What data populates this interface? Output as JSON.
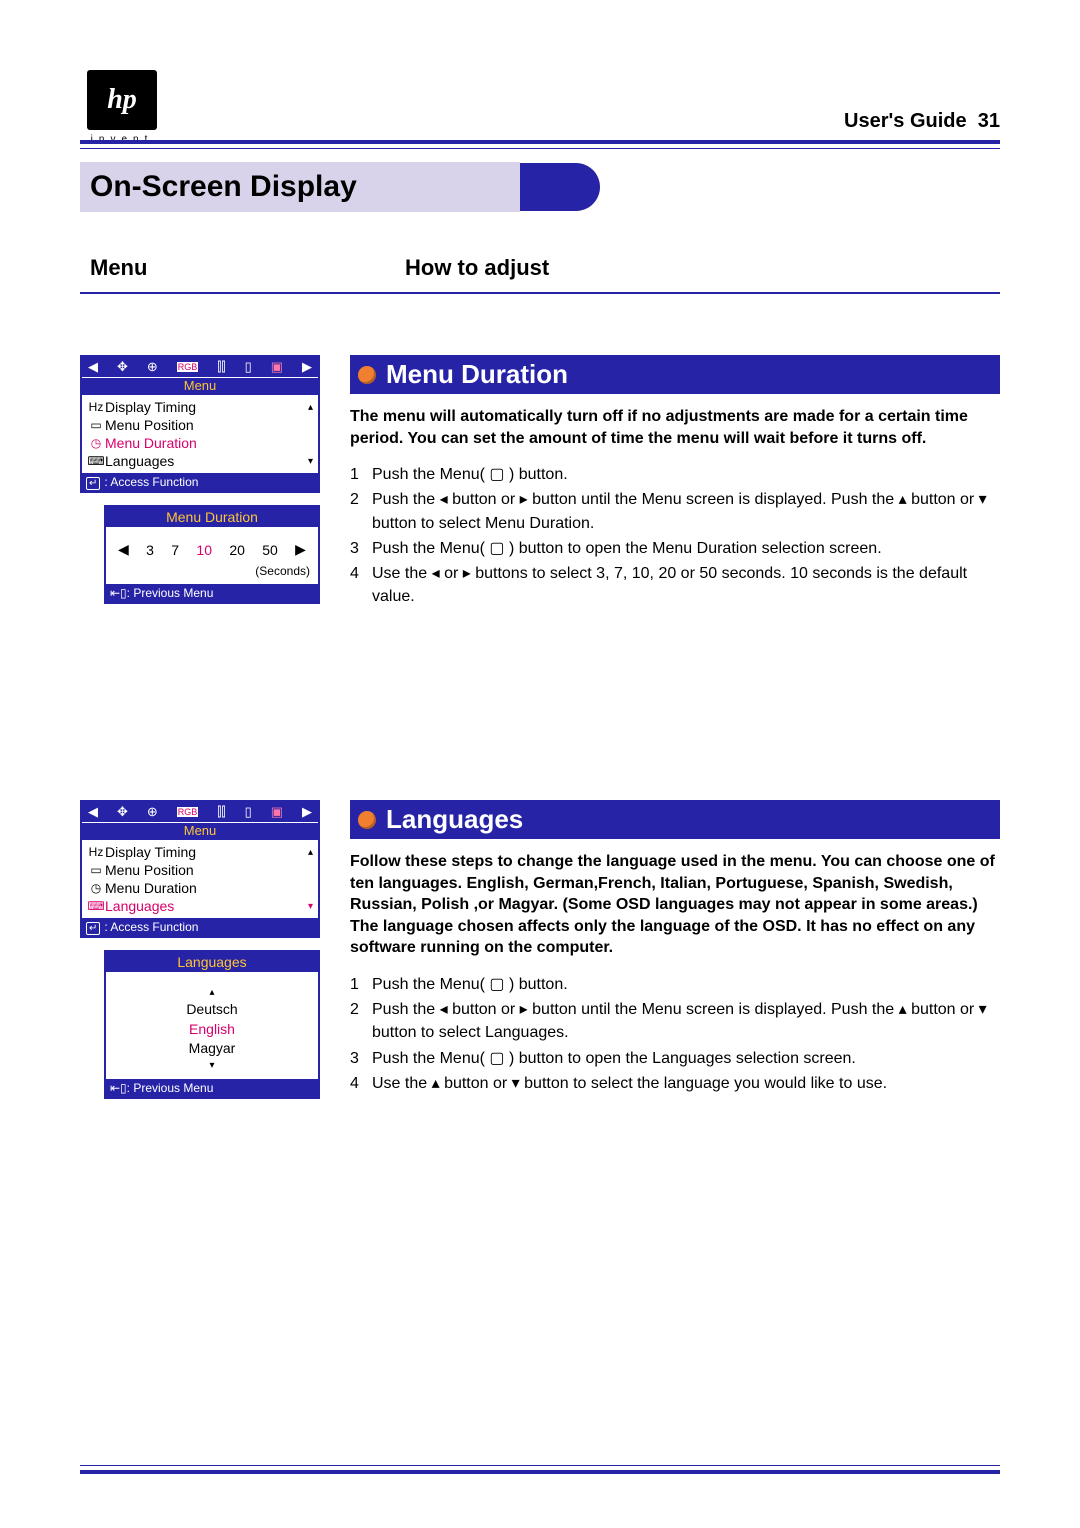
{
  "brand": {
    "logo_text": "hp",
    "tagline": "invent"
  },
  "header": {
    "doc": "User's Guide",
    "page": "31"
  },
  "page_title": "On-Screen Display",
  "columns": {
    "left": "Menu",
    "right": "How to adjust"
  },
  "sections": {
    "menu_duration": {
      "heading": "Menu Duration",
      "intro": "The menu will automatically turn off if no adjustments are made for a certain time period. You can set the amount of time the menu will wait before it turns off.",
      "steps": [
        "Push the Menu( ▢ ) button.",
        "Push the ◂ button or ▸ button until the Menu screen is displayed. Push the ▴ button or ▾ button to select Menu Duration.",
        "Push the Menu( ▢ ) button to open the Menu Duration selection screen.",
        "Use the ◂ or ▸ buttons to select 3, 7, 10, 20 or 50 seconds. 10 seconds is the default value."
      ]
    },
    "languages": {
      "heading": "Languages",
      "intro": "Follow these steps to change the language used in the menu. You can choose one of ten languages. English, German,French, Italian, Portuguese, Spanish, Swedish, Russian, Polish ,or Magyar. (Some OSD languages may not appear in some areas.) The language chosen affects only the language of the OSD. It has no effect on any software running on the computer.",
      "steps": [
        "Push the Menu( ▢ ) button.",
        "Push the ◂ button or ▸ button until the Menu screen is displayed. Push the ▴ button or ▾ button to select Languages.",
        "Push the Menu( ▢ ) button to open the Languages selection screen.",
        "Use the ▴ button or ▾ button to select the language you would like to use."
      ]
    }
  },
  "osd": {
    "menu_label": "Menu",
    "items": [
      {
        "icon": "Hz",
        "label": "Display Timing"
      },
      {
        "icon": "▭",
        "label": "Menu Position"
      },
      {
        "icon": "◷",
        "label": "Menu Duration"
      },
      {
        "icon": "⌨",
        "label": "Languages"
      }
    ],
    "footer": ": Access Function",
    "duration": {
      "title": "Menu Duration",
      "values": [
        "3",
        "7",
        "10",
        "20",
        "50"
      ],
      "active_index": 2,
      "unit": "(Seconds)",
      "footer": ": Previous Menu"
    },
    "languages": {
      "title": "Languages",
      "options": [
        "Deutsch",
        "English",
        "Magyar"
      ],
      "active_index": 1,
      "footer": ": Previous Menu"
    }
  }
}
